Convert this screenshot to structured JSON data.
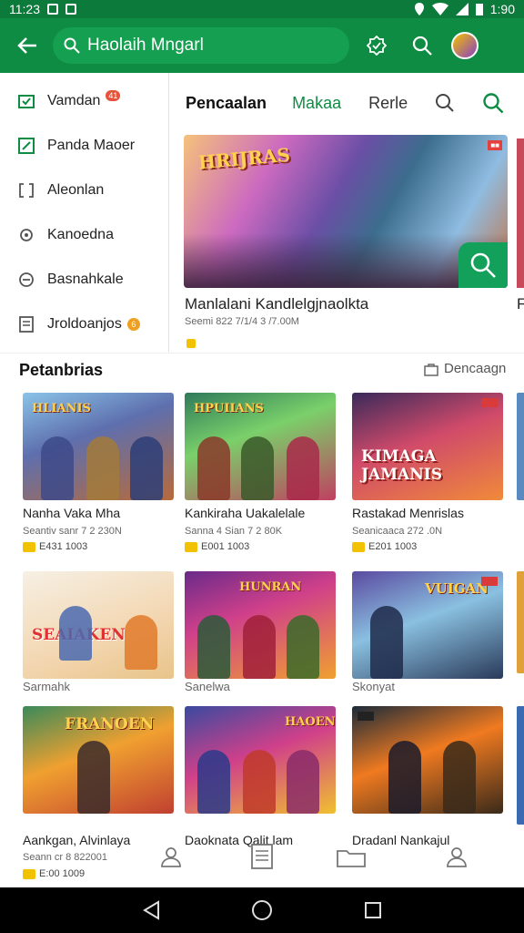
{
  "status_bar": {
    "time": "11:23",
    "battery": "1:90"
  },
  "app_bar": {
    "search_text": "Haolaih Mngarl"
  },
  "sidebar": {
    "items": [
      {
        "label": "Vamdan",
        "badge": "41"
      },
      {
        "label": "Panda Maoer"
      },
      {
        "label": "Aleonlan"
      },
      {
        "label": "Kanoedna"
      },
      {
        "label": "Basnahkale"
      },
      {
        "label": "Jroldoanjos",
        "badge": "6"
      }
    ]
  },
  "tabs": [
    "Pencaalan",
    "Makaa",
    "Rerle"
  ],
  "hero": {
    "logo": "HRIJRAS",
    "title": "Manlalani Kandlelgjnaolkta",
    "meta": "Seemi 822 7/1/4 3 /7.00M",
    "peek_title": "F"
  },
  "section": {
    "title": "Petanbrias",
    "link": "Dencaagn"
  },
  "cards_row1": [
    {
      "title": "Nanha Vaka Mha",
      "sub": "Seantiv sanr 7 2 230N",
      "rating": "E431 1003",
      "logo": "HLIANIS"
    },
    {
      "title": "Kankiraha Uakalelale",
      "sub": "Sanna 4 Sian 7 2 80K",
      "rating": "E001 1003",
      "logo": "HPUIIANS"
    },
    {
      "title": "Rastakad Menrislas",
      "sub": "Seanicaaca 272 .0N",
      "rating": "E201 1003",
      "logo": "KIMAGA JAMANIS"
    }
  ],
  "cards_row2": [
    {
      "title": "Sarmahk",
      "logo": "SEAIAKEN"
    },
    {
      "title": "Sanelwa",
      "logo": "HUNRAN"
    },
    {
      "title": "Skonyat",
      "logo": "VUIGAN"
    }
  ],
  "cards_row3": [
    {
      "title": "Aankgan, Alvinlaya",
      "sub": "Seann cr 8 822001",
      "rating": "E:00 1009",
      "logo": "FRANOEN"
    },
    {
      "title": "Daoknata Qalit lam",
      "logo": "HAOENE"
    },
    {
      "title": "Dradanl Nankajul",
      "logo": ""
    }
  ],
  "colors": {
    "brand": "#0e8c43",
    "accent": "#12a05a"
  }
}
